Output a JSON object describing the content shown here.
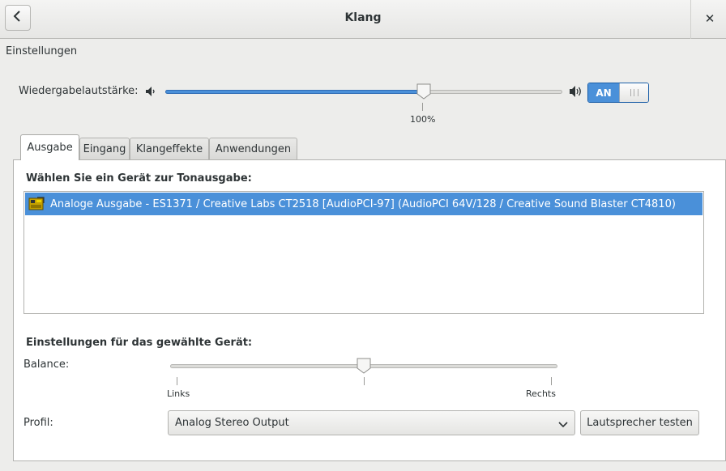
{
  "window": {
    "title": "Klang"
  },
  "header": {
    "section": "Einstellungen"
  },
  "volume": {
    "label": "Wiedergabelautstärke:",
    "level": 0.65,
    "mark_label": "100%",
    "mute_switch": "AN",
    "accent": "#4a90d9"
  },
  "tabs": [
    {
      "label": "Ausgabe",
      "active": true
    },
    {
      "label": "Eingang",
      "active": false
    },
    {
      "label": "Klangeffekte",
      "active": false
    },
    {
      "label": "Anwendungen",
      "active": false
    }
  ],
  "output": {
    "device_heading": "Wählen Sie ein Gerät zur Tonausgabe:",
    "devices": [
      {
        "label": "Analoge Ausgabe - ES1371 / Creative Labs CT2518 [AudioPCI-97] (AudioPCI 64V/128 / Creative Sound Blaster CT4810)",
        "selected": true,
        "icon": "sound-card-icon"
      }
    ],
    "device_settings_heading": "Einstellungen für das gewählte Gerät:",
    "balance": {
      "label": "Balance:",
      "value": 0.5,
      "left_label": "Links",
      "right_label": "Rechts"
    },
    "profile": {
      "label": "Profil:",
      "value": "Analog Stereo Output"
    },
    "test_button": "Lautsprecher testen"
  }
}
